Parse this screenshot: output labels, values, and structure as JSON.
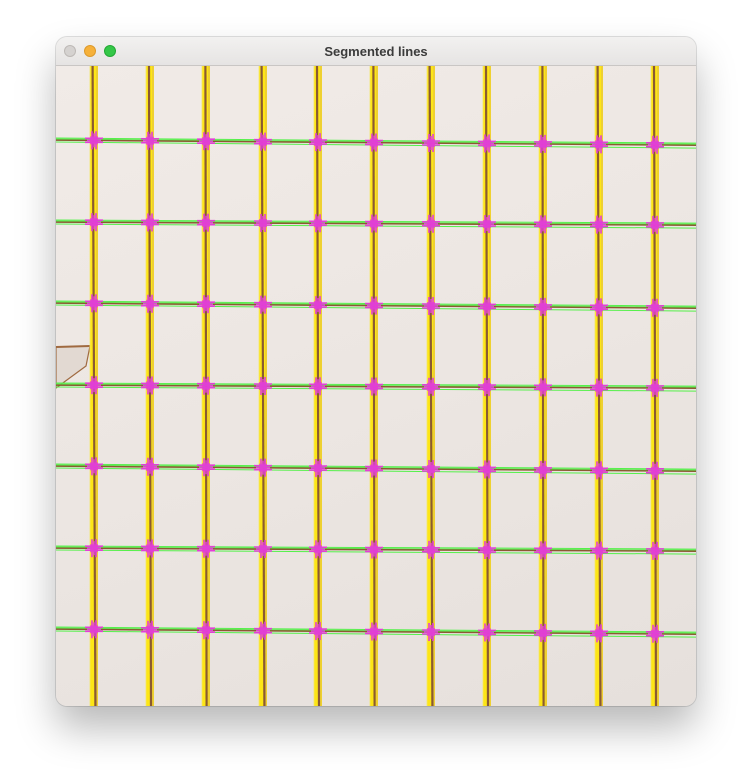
{
  "window": {
    "title": "Segmented lines",
    "buttons": {
      "close": "close-button",
      "minimize": "minimize-button",
      "zoom": "zoom-button"
    }
  },
  "image": {
    "description_colors": {
      "background": "#ede7e3",
      "rod_dark": "#8a5a32",
      "vertical_detection": "#ffe600",
      "horizontal_detection": "#55f04a",
      "intersection_marker": "#e23fd6",
      "fragment": "#a06a40"
    },
    "grid": {
      "columns": 11,
      "rows": 7
    }
  }
}
